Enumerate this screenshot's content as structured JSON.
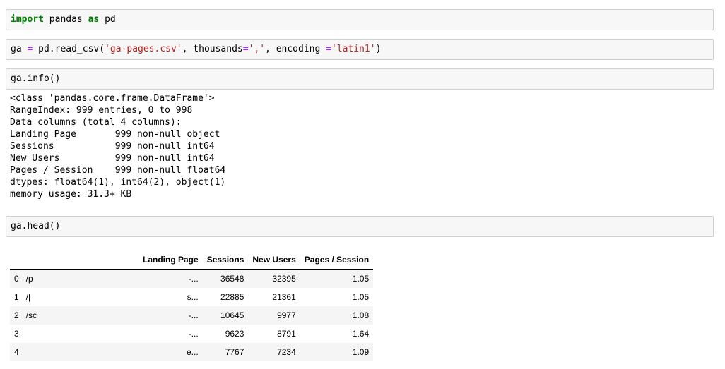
{
  "cells": {
    "c1": {
      "kw1": "import",
      "t1": " pandas ",
      "kw2": "as",
      "t2": " pd"
    },
    "c2": {
      "t1": "ga ",
      "op1": "=",
      "t2": " pd.read_csv(",
      "s1": "'ga-pages.csv'",
      "t3": ", thousands",
      "op2": "=",
      "s2": "','",
      "t4": ", encoding ",
      "op3": "=",
      "s3": "'latin1'",
      "t5": ")"
    },
    "c3": {
      "code": "ga.info()"
    },
    "c4": {
      "code": "ga.head()"
    }
  },
  "info_output": "<class 'pandas.core.frame.DataFrame'>\nRangeIndex: 999 entries, 0 to 998\nData columns (total 4 columns):\nLanding Page       999 non-null object\nSessions           999 non-null int64\nNew Users          999 non-null int64\nPages / Session    999 non-null float64\ndtypes: float64(1), int64(2), object(1)\nmemory usage: 31.3+ KB",
  "table": {
    "headers": [
      "",
      "Landing Page",
      "Sessions",
      "New Users",
      "Pages / Session"
    ],
    "rows": [
      {
        "idx": "0",
        "lp_left": "/p",
        "lp_right": "-...",
        "sessions": "36548",
        "new_users": "32395",
        "pps": "1.05"
      },
      {
        "idx": "1",
        "lp_left": "/|",
        "lp_right": "s...",
        "sessions": "22885",
        "new_users": "21361",
        "pps": "1.05"
      },
      {
        "idx": "2",
        "lp_left": "/sc",
        "lp_right": "-...",
        "sessions": "10645",
        "new_users": "9977",
        "pps": "1.08"
      },
      {
        "idx": "3",
        "lp_left": "",
        "lp_right": "-...",
        "sessions": "9623",
        "new_users": "8791",
        "pps": "1.64"
      },
      {
        "idx": "4",
        "lp_left": "",
        "lp_right": "e...",
        "sessions": "7767",
        "new_users": "7234",
        "pps": "1.09"
      }
    ]
  }
}
